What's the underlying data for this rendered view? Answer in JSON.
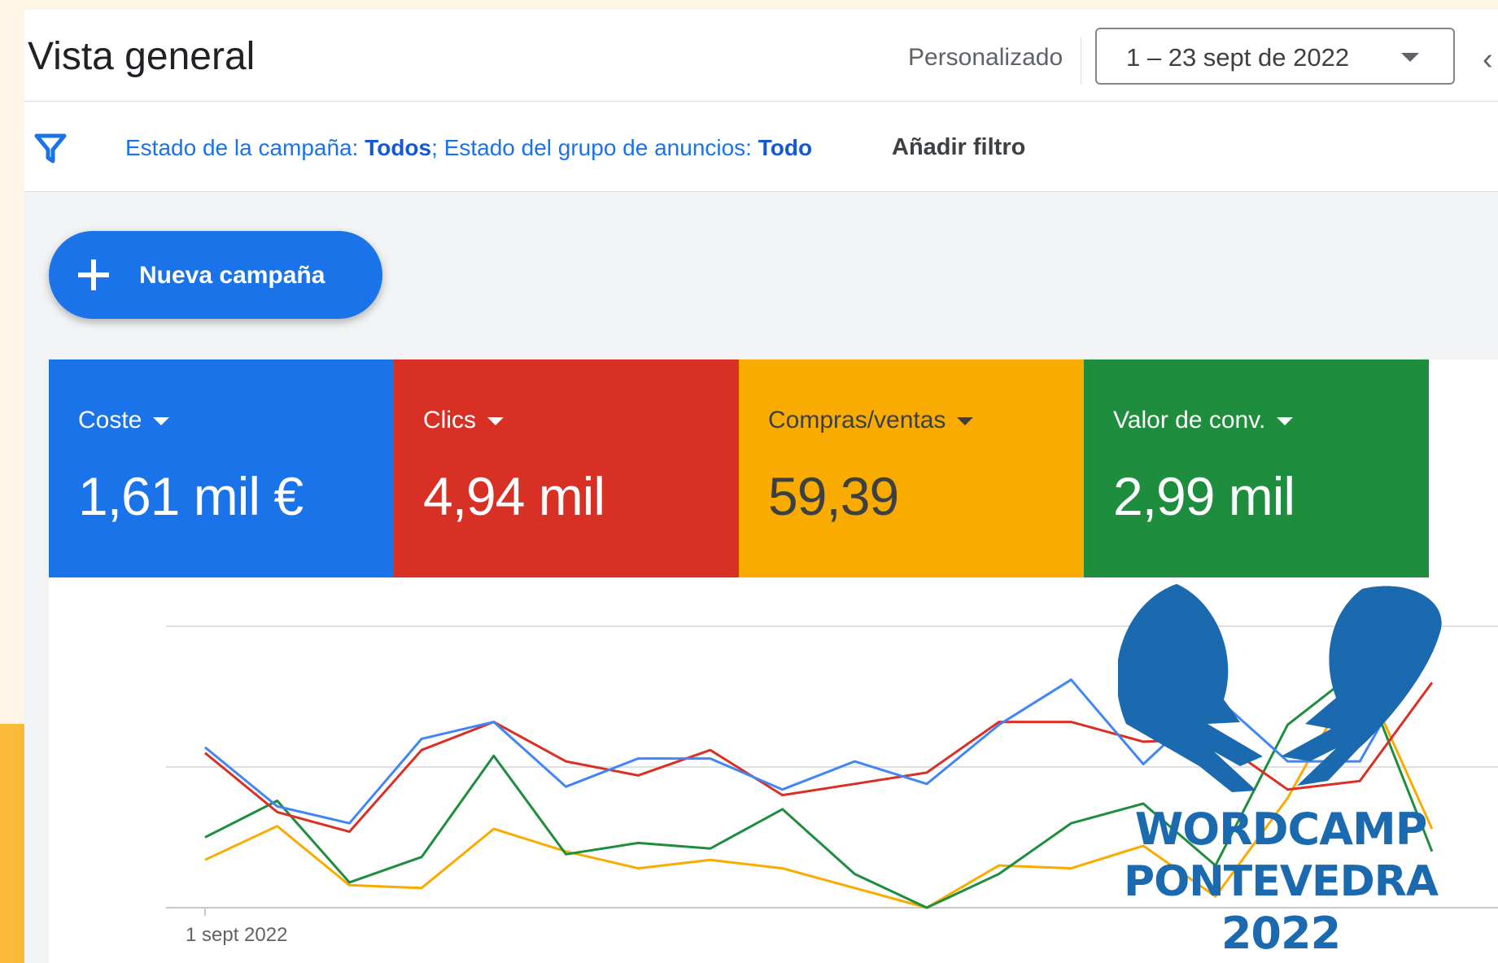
{
  "header": {
    "title": "Vista general",
    "date_range_label": "Personalizado",
    "date_range_value": "1 – 23 sept de 2022",
    "prev_icon": "‹"
  },
  "filters": {
    "campaign_status_label": "Estado de la campaña: ",
    "campaign_status_value": "Todos",
    "separator": "; ",
    "ad_group_status_label": "Estado del grupo de anuncios: ",
    "ad_group_status_value": "Todo",
    "add_filter_label": "Añadir filtro",
    "filter_icon": "filter-icon"
  },
  "new_campaign": {
    "label": "Nueva campaña",
    "icon": "plus-icon"
  },
  "metrics": [
    {
      "label": "Coste",
      "value": "1,61 mil €",
      "color": "#1a73e8"
    },
    {
      "label": "Clics",
      "value": "4,94 mil",
      "color": "#d93025"
    },
    {
      "label": "Compras/ventas",
      "value": "59,39",
      "color": "#f9ab00"
    },
    {
      "label": "Valor de conv.",
      "value": "2,99 mil",
      "color": "#1e8e3e"
    }
  ],
  "chart_data": {
    "type": "line",
    "x_tick_label": "1 sept 2022",
    "grid": true,
    "series": [
      {
        "color": "#4285f4",
        "values": [
          57,
          36,
          30,
          60,
          66,
          43,
          53,
          53,
          42,
          52,
          44,
          65,
          81,
          51,
          75,
          52,
          52,
          97
        ]
      },
      {
        "color": "#d93025",
        "values": [
          55,
          34,
          27,
          56,
          66,
          52,
          47,
          56,
          40,
          44,
          48,
          66,
          66,
          59,
          60,
          42,
          45,
          80
        ]
      },
      {
        "color": "#1e8e3e",
        "values": [
          25,
          38,
          9,
          18,
          54,
          19,
          23,
          21,
          35,
          12,
          0,
          12,
          30,
          37,
          15,
          65,
          85,
          20
        ]
      },
      {
        "color": "#f9ab00",
        "values": [
          17,
          29,
          8,
          7,
          28,
          20,
          14,
          17,
          14,
          7,
          0,
          15,
          14,
          22,
          4,
          39,
          85,
          28
        ]
      }
    ],
    "ylim": [
      0,
      100
    ]
  },
  "logo": {
    "line1": "WORDCAMP",
    "line2": "PONTEVEDRA",
    "line3": "2022",
    "color": "#1b6aaf"
  }
}
